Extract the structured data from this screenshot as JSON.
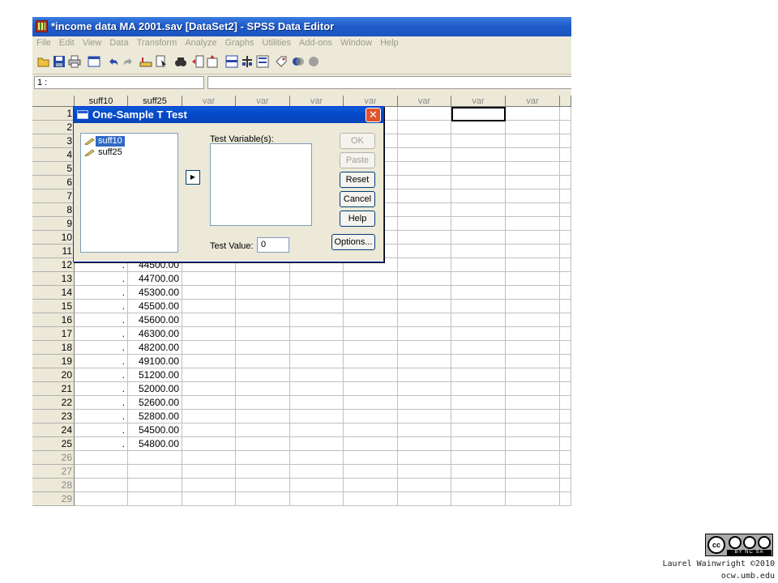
{
  "window": {
    "title": "*income data MA 2001.sav [DataSet2] - SPSS Data Editor",
    "menu": [
      "File",
      "Edit",
      "View",
      "Data",
      "Transform",
      "Analyze",
      "Graphs",
      "Utilities",
      "Add-ons",
      "Window",
      "Help"
    ],
    "toolbar_icons": [
      "open-folder-icon",
      "save-icon",
      "print-icon",
      "dialog-recall-icon",
      "undo-icon",
      "redo-icon",
      "go-to-case-icon",
      "variables-icon",
      "find-icon",
      "insert-cases-icon",
      "insert-variable-icon",
      "split-file-icon",
      "weight-cases-icon",
      "select-cases-icon",
      "value-labels-icon",
      "use-sets-icon",
      "show-all-icon"
    ],
    "cell_ref": "1 :",
    "cell_value": ""
  },
  "grid": {
    "headers": [
      "suff10",
      "suff25",
      "var",
      "var",
      "var",
      "var",
      "var",
      "var",
      "var"
    ],
    "rows": [
      {
        "n": "1",
        "c1": "",
        "c2": ""
      },
      {
        "n": "2",
        "c1": "",
        "c2": ""
      },
      {
        "n": "3",
        "c1": "",
        "c2": ""
      },
      {
        "n": "4",
        "c1": "",
        "c2": ""
      },
      {
        "n": "5",
        "c1": "",
        "c2": ""
      },
      {
        "n": "6",
        "c1": "",
        "c2": ""
      },
      {
        "n": "7",
        "c1": "",
        "c2": ""
      },
      {
        "n": "8",
        "c1": "",
        "c2": ""
      },
      {
        "n": "9",
        "c1": "",
        "c2": ""
      },
      {
        "n": "10",
        "c1": "",
        "c2": ""
      },
      {
        "n": "11",
        "c1": "",
        "c2": ""
      },
      {
        "n": "12",
        "c1": ".",
        "c2": "44500.00"
      },
      {
        "n": "13",
        "c1": ".",
        "c2": "44700.00"
      },
      {
        "n": "14",
        "c1": ".",
        "c2": "45300.00"
      },
      {
        "n": "15",
        "c1": ".",
        "c2": "45500.00"
      },
      {
        "n": "16",
        "c1": ".",
        "c2": "45600.00"
      },
      {
        "n": "17",
        "c1": ".",
        "c2": "46300.00"
      },
      {
        "n": "18",
        "c1": ".",
        "c2": "48200.00"
      },
      {
        "n": "19",
        "c1": ".",
        "c2": "49100.00"
      },
      {
        "n": "20",
        "c1": ".",
        "c2": "51200.00"
      },
      {
        "n": "21",
        "c1": ".",
        "c2": "52000.00"
      },
      {
        "n": "22",
        "c1": ".",
        "c2": "52600.00"
      },
      {
        "n": "23",
        "c1": ".",
        "c2": "52800.00"
      },
      {
        "n": "24",
        "c1": ".",
        "c2": "54500.00"
      },
      {
        "n": "25",
        "c1": ".",
        "c2": "54800.00"
      },
      {
        "n": "26",
        "c1": "",
        "c2": "",
        "empty": true
      },
      {
        "n": "27",
        "c1": "",
        "c2": "",
        "empty": true
      },
      {
        "n": "28",
        "c1": "",
        "c2": "",
        "empty": true
      },
      {
        "n": "29",
        "c1": "",
        "c2": "",
        "empty": true
      }
    ]
  },
  "dialog": {
    "title": "One-Sample T Test",
    "source_variables": [
      "suff10",
      "suff25"
    ],
    "selected_variable": "suff10",
    "test_variables_label": "Test Variable(s):",
    "test_value_label": "Test Value:",
    "test_value": "0",
    "buttons": {
      "ok": "OK",
      "paste": "Paste",
      "reset": "Reset",
      "cancel": "Cancel",
      "help": "Help",
      "options": "Options..."
    },
    "disabled_buttons": [
      "OK",
      "Paste"
    ]
  },
  "footer": {
    "license_text": "BY NC SA",
    "credit": "Laurel Wainwright ©2010",
    "site": "ocw.umb.edu"
  }
}
